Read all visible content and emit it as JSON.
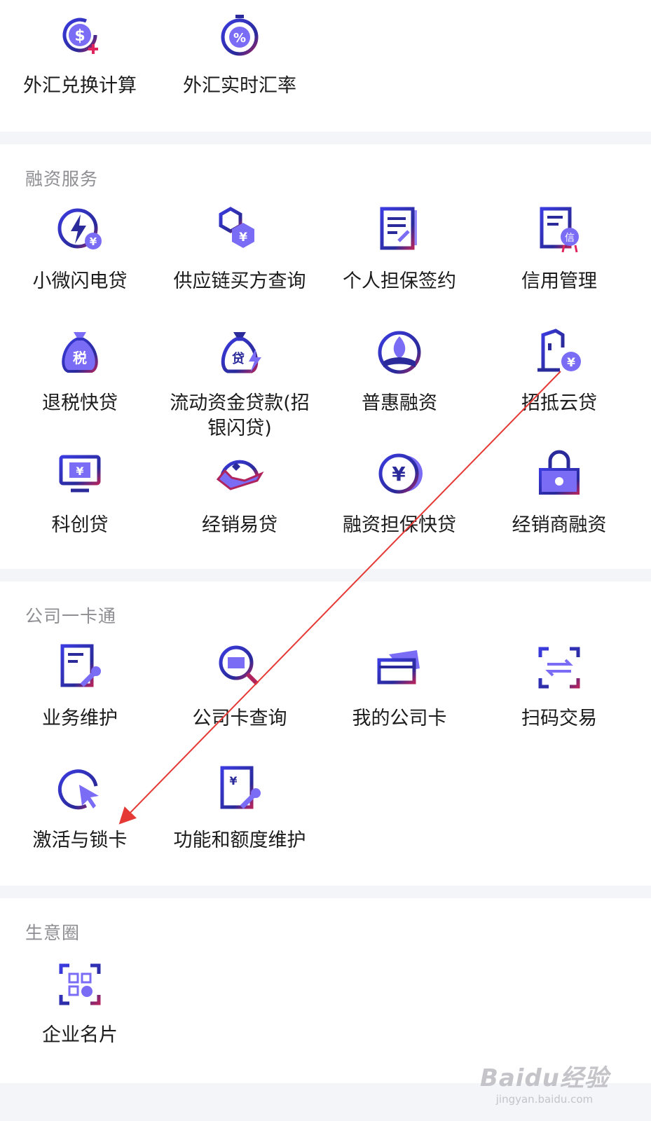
{
  "sections": {
    "fx": {
      "items": [
        {
          "label": "外汇兑换计算",
          "icon": "currency-exchange-calculator-icon"
        },
        {
          "label": "外汇实时汇率",
          "icon": "realtime-rate-stopwatch-icon"
        }
      ]
    },
    "financing": {
      "title": "融资服务",
      "items": [
        {
          "label": "小微闪电贷",
          "icon": "lightning-loan-icon"
        },
        {
          "label": "供应链买方查询",
          "icon": "supply-chain-icon"
        },
        {
          "label": "个人担保签约",
          "icon": "guarantee-sign-document-icon"
        },
        {
          "label": "信用管理",
          "icon": "credit-management-icon"
        },
        {
          "label": "退税快贷",
          "icon": "tax-refund-bag-icon"
        },
        {
          "label": "流动资金贷款(招银闪贷)",
          "icon": "working-capital-loan-bag-icon"
        },
        {
          "label": "普惠融资",
          "icon": "inclusive-finance-icon"
        },
        {
          "label": "招抵云贷",
          "icon": "mortgage-cloud-loan-icon"
        },
        {
          "label": "科创贷",
          "icon": "tech-innovation-monitor-icon"
        },
        {
          "label": "经销易贷",
          "icon": "dealer-easy-loan-hand-icon"
        },
        {
          "label": "融资担保快贷",
          "icon": "yuan-coin-icon"
        },
        {
          "label": "经销商融资",
          "icon": "dealer-financing-lock-icon"
        }
      ]
    },
    "card": {
      "title": "公司一卡通",
      "items": [
        {
          "label": "业务维护",
          "icon": "business-maintenance-wrench-icon"
        },
        {
          "label": "公司卡查询",
          "icon": "card-search-magnifier-icon"
        },
        {
          "label": "我的公司卡",
          "icon": "my-company-card-icon"
        },
        {
          "label": "扫码交易",
          "icon": "scan-transaction-icon"
        },
        {
          "label": "激活与锁卡",
          "icon": "activate-lock-card-cursor-icon"
        },
        {
          "label": "功能和额度维护",
          "icon": "function-limit-maintenance-icon"
        }
      ]
    },
    "business": {
      "title": "生意圈",
      "items": [
        {
          "label": "企业名片",
          "icon": "business-card-qr-icon"
        }
      ]
    }
  },
  "colors": {
    "icon_dark": "#2a2a9a",
    "icon_light": "#7b6cf6",
    "icon_accent": "#e0245e",
    "annotation_arrow": "#e53935",
    "section_title": "#8e8e93",
    "divider": "#f4f5f8"
  },
  "watermark": {
    "logo": "Baidu经验",
    "url": "jingyan.baidu.com"
  }
}
